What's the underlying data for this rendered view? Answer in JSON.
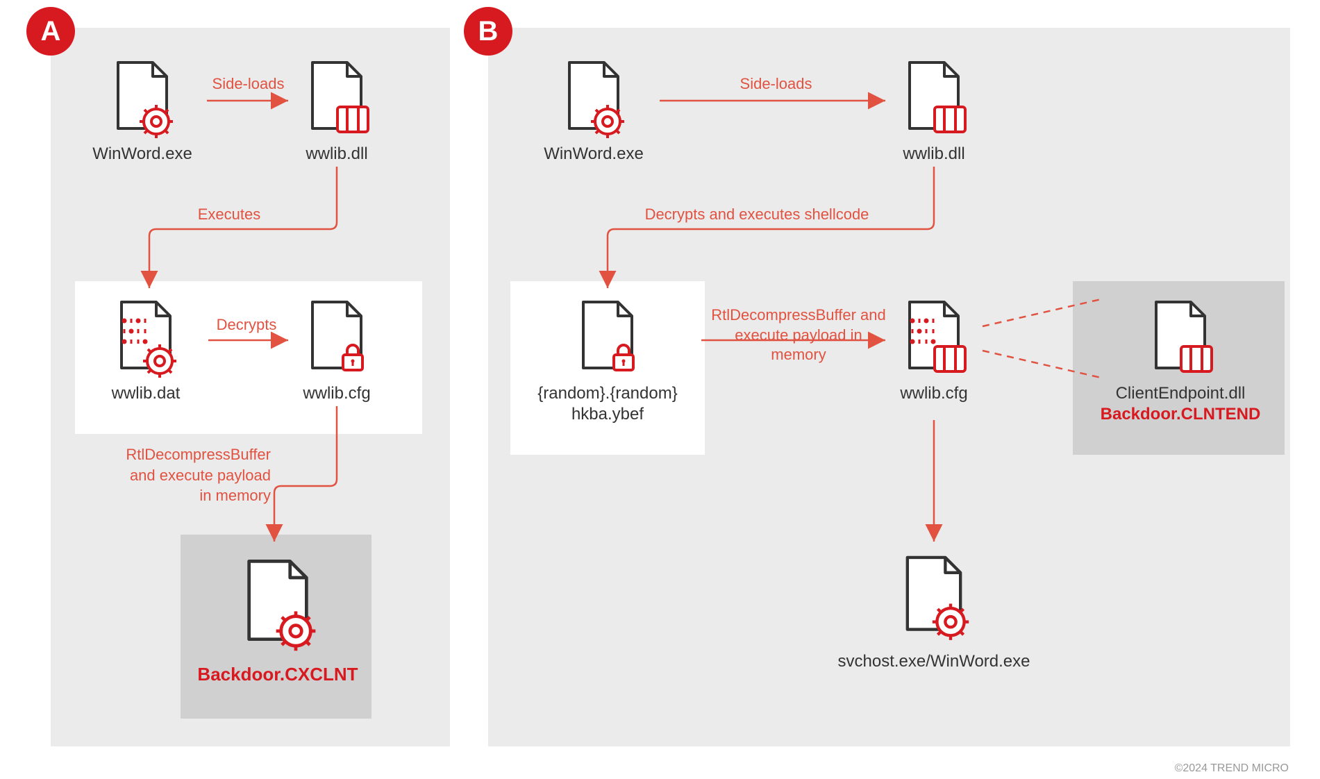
{
  "badges": {
    "a": "A",
    "b": "B"
  },
  "panel_a": {
    "node1": "WinWord.exe",
    "node2": "wwlib.dll",
    "node3": "wwlib.dat",
    "node4": "wwlib.cfg",
    "node5": "Backdoor.CXCLNT",
    "arrow1": "Side-loads",
    "arrow2": "Executes",
    "arrow3": "Decrypts",
    "arrow4_l1": "RtlDecompressBuffer",
    "arrow4_l2": "and execute payload",
    "arrow4_l3": "in memory"
  },
  "panel_b": {
    "node1": "WinWord.exe",
    "node2": "wwlib.dll",
    "node3_l1": "{random}.{random}",
    "node3_l2": "hkba.ybef",
    "node4": "wwlib.cfg",
    "node5": "svchost.exe/WinWord.exe",
    "node6_l1": "ClientEndpoint.dll",
    "node6_l2": "Backdoor.CLNTEND",
    "arrow1": "Side-loads",
    "arrow2": "Decrypts and executes shellcode",
    "arrow3_l1": "RtlDecompressBuffer and",
    "arrow3_l2": "execute payload in memory"
  },
  "copyright": "©2024 TREND MICRO"
}
